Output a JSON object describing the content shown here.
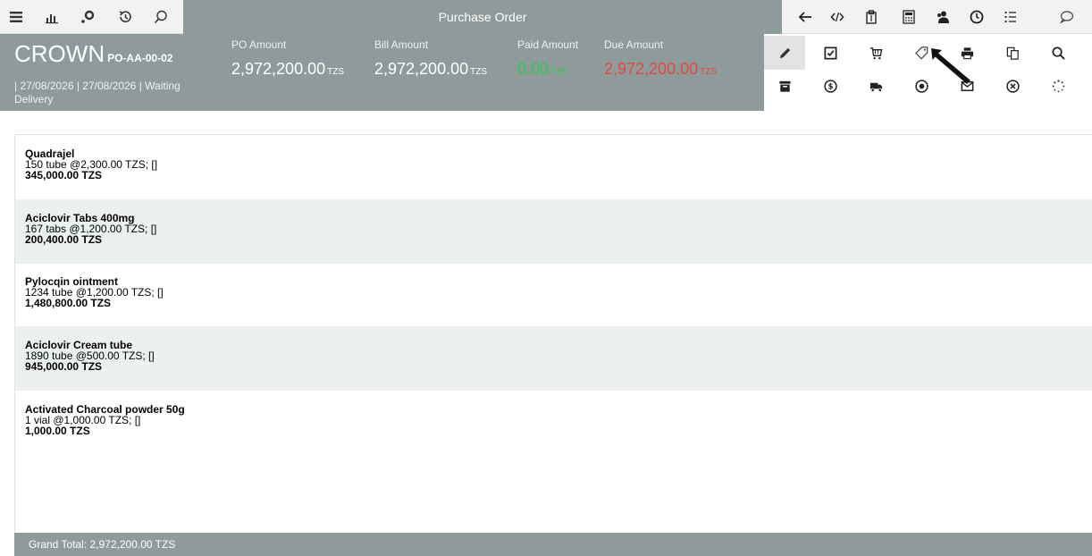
{
  "app": {
    "title": "Purchase Order"
  },
  "header": {
    "supplier": "CROWN",
    "po_code": "PO-AA-00-02",
    "meta_line": "| 27/08/2026 | 27/08/2026 | Waiting Delivery",
    "amounts": [
      {
        "label": "PO Amount",
        "value": "2,972,200.00",
        "currency": "TZS"
      },
      {
        "label": "Bill Amount",
        "value": "2,972,200.00",
        "currency": "TZS"
      },
      {
        "label": "Paid Amount",
        "value": "0.00",
        "currency": "TZS",
        "color": "#34c653"
      },
      {
        "label": "Due Amount",
        "value": "2,972,200.00",
        "currency": "TZS",
        "color": "#e3473f"
      }
    ]
  },
  "toolbar_left_icons": [
    "menu-icon",
    "bar-chart-icon",
    "settings-icon",
    "history-icon",
    "search-icon"
  ],
  "toolbar_right_icons": [
    "back-arrow-icon",
    "code-icon",
    "clipboard-icon",
    "calculator-icon",
    "users-icon",
    "clock-icon",
    "list-icon",
    "comment-icon"
  ],
  "action_icons_row1": [
    "edit-icon",
    "checkbox-icon",
    "cart-icon",
    "tag-icon",
    "print-icon",
    "copy-icon",
    "search-icon"
  ],
  "action_icons_row2": [
    "archive-icon",
    "dollar-icon",
    "truck-icon",
    "record-icon",
    "mail-icon",
    "cancel-icon",
    "spinner-icon"
  ],
  "items": [
    {
      "name": "Quadrajel",
      "detail": "150 tube @2,300.00 TZS; []",
      "total": "345,000.00 TZS"
    },
    {
      "name": "Aciclovir Tabs 400mg",
      "detail": "167 tabs @1,200.00 TZS; []",
      "total": "200,400.00 TZS"
    },
    {
      "name": "Pylocqin ointment",
      "detail": "1234 tube @1,200.00 TZS; []",
      "total": "1,480,800.00 TZS"
    },
    {
      "name": "Aciclovir Cream tube",
      "detail": "1890 tube @500.00 TZS; []",
      "total": "945,000.00 TZS"
    },
    {
      "name": "Activated Charcoal powder 50g",
      "detail": "1 vial @1,000.00 TZS; []",
      "total": "1,000.00 TZS"
    }
  ],
  "footer": {
    "grand_total": "Grand Total: 2,972,200.00 TZS"
  },
  "colors": {
    "header_bg": "#8f9b9b",
    "paid": "#34c653",
    "due": "#e3473f",
    "row_alt": "#edf0f0"
  }
}
